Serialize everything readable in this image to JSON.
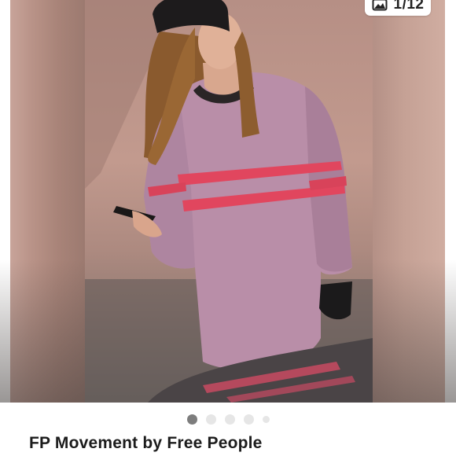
{
  "gallery": {
    "counter_text": "1/12",
    "counter_icon": "image-gallery-icon",
    "total_dots": 5,
    "active_dot": 0
  },
  "listing": {
    "brand": "FP Movement by Free People"
  },
  "colors": {
    "sweater": "#b98ea8",
    "stripe": "#e1465e",
    "background": "#ffffff"
  }
}
